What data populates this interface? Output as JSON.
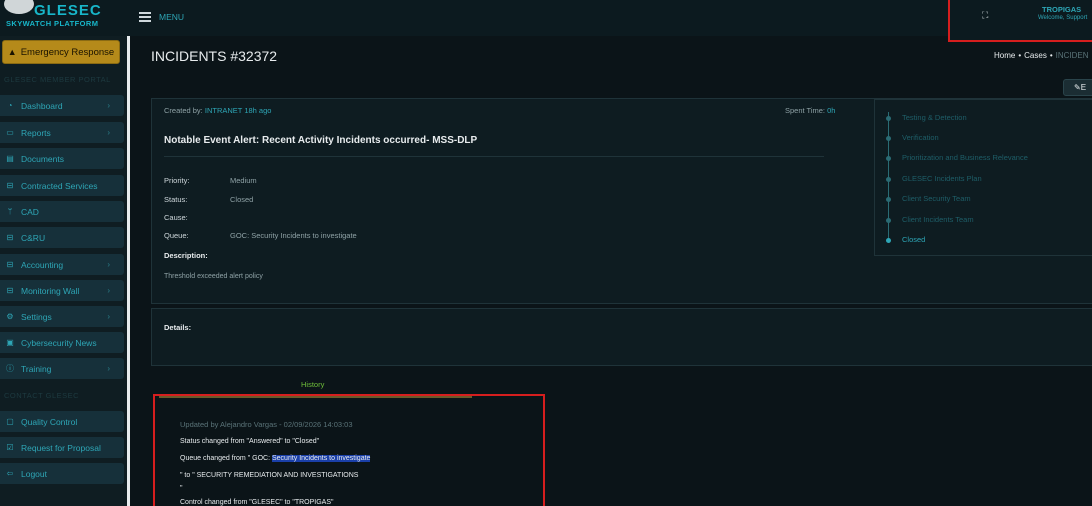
{
  "brand": {
    "name": "GLESEC",
    "subtitle": "SKYWATCH PLATFORM"
  },
  "topbar": {
    "menu_label": "MENU",
    "user_name": "TROPIGAS",
    "user_welcome": "Welcome, Support"
  },
  "sidebar": {
    "emergency_label": "Emergency Response",
    "section_member": "GLESEC MEMBER PORTAL",
    "section_contact": "CONTACT GLESEC",
    "items": [
      {
        "label": "Dashboard",
        "icon": "dashboard-icon"
      },
      {
        "label": "Reports",
        "icon": "monitor-icon"
      },
      {
        "label": "Documents",
        "icon": "document-icon"
      },
      {
        "label": "Contracted Services",
        "icon": "briefcase-icon"
      },
      {
        "label": "CAD",
        "icon": "antenna-icon"
      },
      {
        "label": "C&RU",
        "icon": "briefcase-icon"
      },
      {
        "label": "Accounting",
        "icon": "briefcase-icon"
      },
      {
        "label": "Monitoring Wall",
        "icon": "briefcase-icon"
      },
      {
        "label": "Settings",
        "icon": "gear-icon"
      },
      {
        "label": "Cybersecurity News",
        "icon": "news-icon"
      },
      {
        "label": "Training",
        "icon": "info-icon"
      }
    ],
    "contact_items": [
      {
        "label": "Quality Control",
        "icon": "clipboard-icon"
      },
      {
        "label": "Request for Proposal",
        "icon": "checklist-icon"
      },
      {
        "label": "Logout",
        "icon": "logout-icon"
      }
    ]
  },
  "page": {
    "title": "INCIDENTS #32372",
    "breadcrumb": {
      "home": "Home",
      "cases": "Cases",
      "current": "INCIDEN"
    },
    "edit_label": "E"
  },
  "incident": {
    "created_prefix": "Created by:",
    "created_by": "INTRANET 18h ago",
    "spent_prefix": "Spent Time:",
    "spent_value": "0h",
    "title": "Notable Event Alert: Recent Activity Incidents occurred- MSS-DLP",
    "fields": [
      {
        "label": "Priority:",
        "value": "Medium"
      },
      {
        "label": "Status:",
        "value": "Closed"
      },
      {
        "label": "Cause:",
        "value": ""
      },
      {
        "label": "Queue:",
        "value": "GOC: Security Incidents to investigate"
      }
    ],
    "description_label": "Description:",
    "description": "Threshold exceeded alert policy",
    "details_label": "Details:"
  },
  "timeline": {
    "steps": [
      "Testing & Detection",
      "Verification",
      "Prioritization and Business Relevance",
      "GLESEC Incidents Plan",
      "Client Security Team",
      "Client Incidents Team",
      "Closed"
    ],
    "active_step": "Closed"
  },
  "history": {
    "tab_label": "History",
    "updated": "Updated by Alejandro Vargas - 02/09/2026 14:03:03",
    "line1": "Status changed from \"Answered\" to \"Closed\"",
    "line2_prefix": "Queue changed from \" GOC: ",
    "line2_highlight": "Security Incidents to investigate",
    "line3": "\" to \" SECURITY REMEDIATION AND INVESTIGATIONS",
    "line4": "\"",
    "line5": "Control changed from \"GLESEC\" to \"TROPIGAS\""
  },
  "colors": {
    "accent": "#2ea6b6",
    "highlight_box": "#d61e1e",
    "emergency": "#b58a1a"
  }
}
